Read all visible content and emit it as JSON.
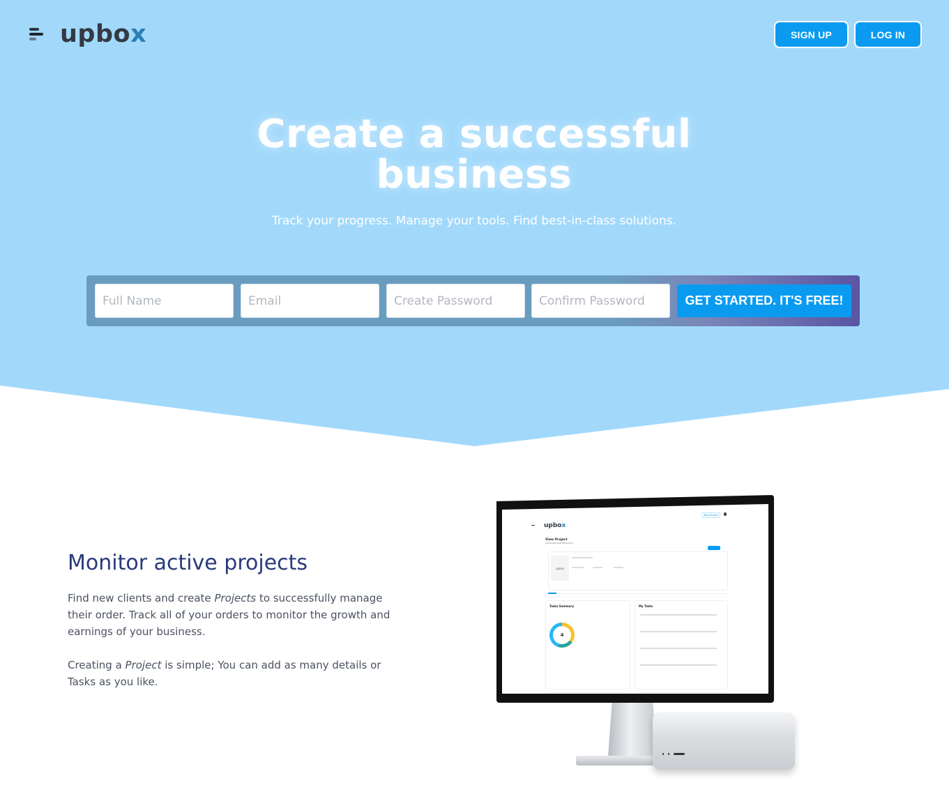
{
  "brand": {
    "name_main": "upbo",
    "name_x": "x"
  },
  "nav": {
    "signup_label": "SIGN UP",
    "login_label": "LOG IN"
  },
  "hero": {
    "title_line1": "Create a successful",
    "title_line2": "business",
    "subtitle": "Track your progress. Manage your tools. Find best-in-class solutions."
  },
  "signup_form": {
    "full_name_placeholder": "Full Name",
    "email_placeholder": "Email",
    "password_placeholder": "Create Password",
    "confirm_placeholder": "Confirm Password",
    "cta_label": "GET STARTED. IT'S FREE!"
  },
  "feature": {
    "title": "Monitor active projects",
    "p1_a": "Find new clients and create ",
    "p1_em": "Projects",
    "p1_b": " to successfully manage their order. Track all of your orders to monitor the growth and earnings of your business.",
    "p2_a": "Creating a ",
    "p2_em": "Project",
    "p2_b": " is simple; You can add as many details or Tasks as you like."
  },
  "mockup": {
    "logo_main": "upbo",
    "logo_x": "x",
    "new_button": "New Project",
    "page_title": "View Project",
    "thumb_logo": "upbox",
    "donut_value": "4",
    "tasks_title": "Tasks Summary",
    "my_tasks_title": "My Tasks"
  },
  "colors": {
    "hero_bg": "#a2d9fb",
    "accent_blue": "#0a9bf0",
    "title_navy": "#283a7a"
  }
}
